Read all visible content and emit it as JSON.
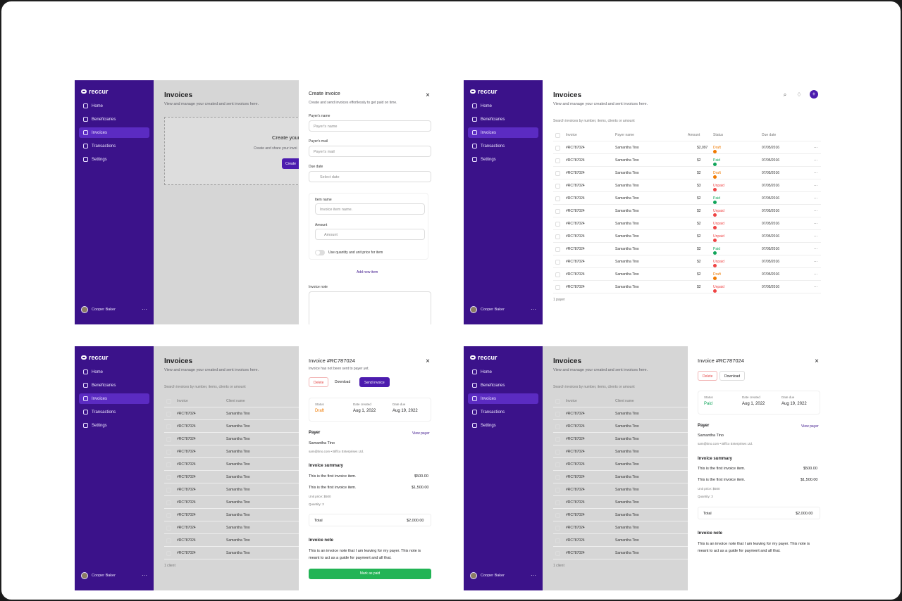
{
  "app": {
    "logo": "reccur",
    "nav": [
      "Home",
      "Beneficiaries",
      "Invoices",
      "Transactions",
      "Settings"
    ],
    "user": "Cooper Baker"
  },
  "page": {
    "title": "Invoices",
    "subtitle": "View and manage your created and sent invoices here.",
    "search": "Search invoices by number, items, clients or amount",
    "pager1": "1 payer",
    "pager2": "1 client"
  },
  "empty": {
    "title": "Create your",
    "subtitle": "Create and share your invoi",
    "button": "Create"
  },
  "create": {
    "title": "Create invoice",
    "close": "×",
    "subtitle": "Create and send invoices effortlessly to get paid on time.",
    "payer_name_label": "Payer's name",
    "payer_name_placeholder": "Payer's name",
    "payer_mail_label": "Payer's mail",
    "payer_mail_placeholder": "Payer's mail",
    "due_label": "Due date",
    "due_placeholder": "Select date",
    "item_label": "Item name",
    "item_placeholder": "Invoice item name.",
    "amount_label": "Amount",
    "amount_placeholder": "Amount",
    "currency": "$",
    "toggle_label": "Use quantity and unit price for item",
    "add_item": "Add new item",
    "note_label": "Invoice note"
  },
  "columns": {
    "invoice": "Invoice",
    "payer": "Payer name",
    "amount": "Amount",
    "status": "Status",
    "due": "Due date",
    "client": "Client name"
  },
  "rows": [
    {
      "id": "#RC787024",
      "payer": "Samantha Tino",
      "amount": "$2,097",
      "status": "Draft",
      "due": "07/05/2016",
      "color": "#f07a00"
    },
    {
      "id": "#RC787024",
      "payer": "Samantha Tino",
      "amount": "$2",
      "status": "Paid",
      "due": "07/05/2016",
      "color": "#11a55a"
    },
    {
      "id": "#RC787024",
      "payer": "Samantha Tino",
      "amount": "$2",
      "status": "Draft",
      "due": "07/05/2016",
      "color": "#f07a00"
    },
    {
      "id": "#RC787024",
      "payer": "Samantha Tino",
      "amount": "$3",
      "status": "Unpaid",
      "due": "07/05/2016",
      "color": "#ef4343"
    },
    {
      "id": "#RC787024",
      "payer": "Samantha Tino",
      "amount": "$2",
      "status": "Paid",
      "due": "07/05/2016",
      "color": "#11a55a"
    },
    {
      "id": "#RC787024",
      "payer": "Samantha Tino",
      "amount": "$2",
      "status": "Unpaid",
      "due": "07/05/2016",
      "color": "#ef4343"
    },
    {
      "id": "#RC787024",
      "payer": "Samantha Tino",
      "amount": "$2",
      "status": "Unpaid",
      "due": "07/05/2016",
      "color": "#ef4343"
    },
    {
      "id": "#RC787024",
      "payer": "Samantha Tino",
      "amount": "$2",
      "status": "Unpaid",
      "due": "07/05/2016",
      "color": "#ef4343"
    },
    {
      "id": "#RC787024",
      "payer": "Samantha Tino",
      "amount": "$2",
      "status": "Paid",
      "due": "07/05/2016",
      "color": "#11a55a"
    },
    {
      "id": "#RC787024",
      "payer": "Samantha Tino",
      "amount": "$2",
      "status": "Unpaid",
      "due": "07/05/2016",
      "color": "#ef4343"
    },
    {
      "id": "#RC787024",
      "payer": "Samantha Tino",
      "amount": "$2",
      "status": "Draft",
      "due": "07/05/2016",
      "color": "#f07a00"
    },
    {
      "id": "#RC787024",
      "payer": "Samantha Tino",
      "amount": "$2",
      "status": "Unpaid",
      "due": "07/05/2016",
      "color": "#ef4343"
    }
  ],
  "detail": {
    "title": "Invoice #RC787024",
    "not_sent": "Invoice has not been sent to payer yet.",
    "delete": "Delete",
    "download": "Download",
    "send": "Send invoice",
    "status_label": "Status",
    "created_label": "Date created",
    "due_label": "Date due",
    "draft": "Draft",
    "paid": "Paid",
    "created": "Aug 1, 2022",
    "due": "Aug 19, 2022",
    "payer_heading": "Payer",
    "view_payer": "View payer",
    "payer_name": "Samantha Tino",
    "payer_email": "sam@tino.com • Biffco Enterprises Ltd.",
    "summary_heading": "Invoice summary",
    "item1": "This is the first invoice item.",
    "amount1": "$500.00",
    "item2": "This is the first invoice item.",
    "amount2": "$1,500.00",
    "unit": "Unit price: $500",
    "quantity": "Quantity: 3",
    "total_label": "Total",
    "total": "$2,000.00",
    "note_heading": "Invoice note",
    "note": "This is an invoice note that I am leaving for my payer. This note is meant to act as a guide for payment and all that.",
    "mark_paid": "Mark as paid"
  }
}
